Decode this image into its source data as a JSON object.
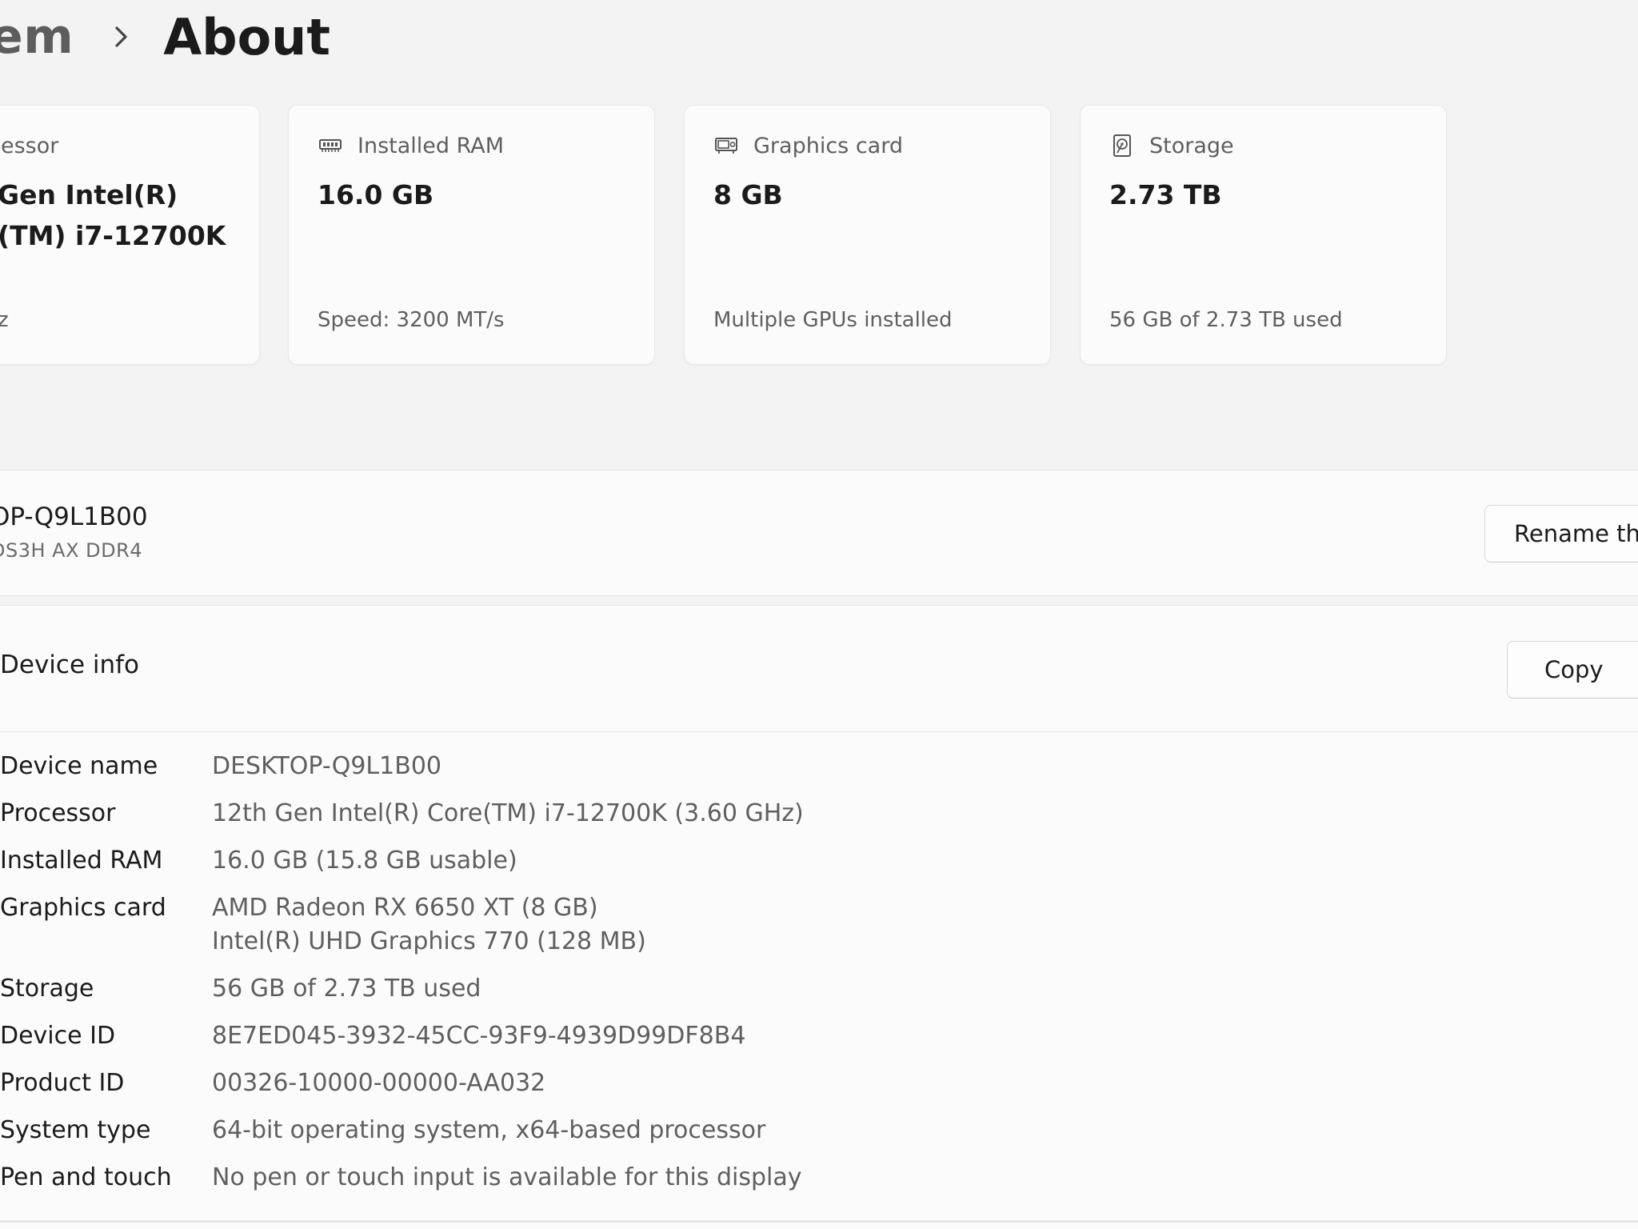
{
  "breadcrumb": {
    "parent": "em",
    "current": "About"
  },
  "cards": [
    {
      "label": "essor",
      "value_lines": [
        "Gen Intel(R)",
        "(TM) i7-12700K"
      ],
      "sub": "z",
      "icon": "processor-icon"
    },
    {
      "label": "Installed RAM",
      "value_lines": [
        "16.0 GB"
      ],
      "sub": "Speed: 3200 MT/s",
      "icon": "ram-icon"
    },
    {
      "label": "Graphics card",
      "value_lines": [
        "8 GB"
      ],
      "sub": "Multiple GPUs installed",
      "icon": "gpu-icon"
    },
    {
      "label": "Storage",
      "value_lines": [
        "2.73 TB"
      ],
      "sub": "56 GB of 2.73 TB used",
      "icon": "storage-icon"
    }
  ],
  "device": {
    "name": "OP-Q9L1B00",
    "model": "DS3H AX DDR4",
    "rename_label": "Rename th"
  },
  "device_info": {
    "title": "Device info",
    "copy_label": "Copy",
    "rows": [
      {
        "key": "Device name",
        "values": [
          "DESKTOP-Q9L1B00"
        ]
      },
      {
        "key": "Processor",
        "values": [
          "12th Gen Intel(R) Core(TM) i7-12700K (3.60 GHz)"
        ]
      },
      {
        "key": "Installed RAM",
        "values": [
          "16.0 GB (15.8 GB usable)"
        ]
      },
      {
        "key": "Graphics card",
        "values": [
          "AMD Radeon RX 6650 XT (8 GB)",
          "Intel(R) UHD Graphics 770 (128 MB)"
        ]
      },
      {
        "key": "Storage",
        "values": [
          "56 GB of 2.73 TB used"
        ]
      },
      {
        "key": "Device ID",
        "values": [
          "8E7ED045-3932-45CC-93F9-4939D99DF8B4"
        ]
      },
      {
        "key": "Product ID",
        "values": [
          "00326-10000-00000-AA032"
        ]
      },
      {
        "key": "System type",
        "values": [
          "64-bit operating system, x64-based processor"
        ]
      },
      {
        "key": "Pen and touch",
        "values": [
          "No pen or touch input is available for this display"
        ]
      }
    ]
  }
}
